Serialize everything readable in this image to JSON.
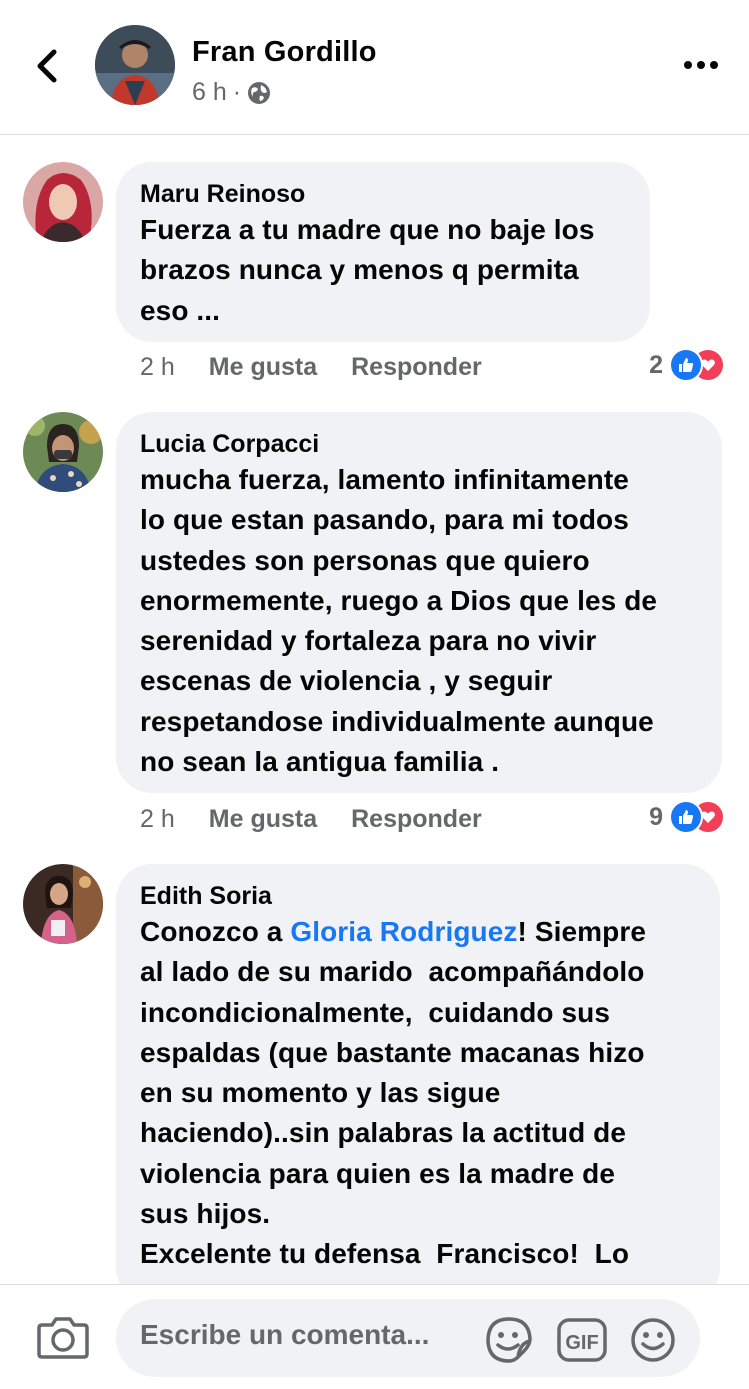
{
  "header": {
    "name": "Fran Gordillo",
    "time": "6 h",
    "separator": "·",
    "back_icon": "chevron-left-icon",
    "privacy_icon": "globe-icon",
    "more_icon": "more-dots-icon"
  },
  "comments": [
    {
      "author": "Maru Reinoso",
      "text": "Fuerza a tu madre que no baje los\nbrazos nunca y menos q permita\neso ...",
      "time": "2 h",
      "like_label": "Me gusta",
      "reply_label": "Responder",
      "reaction_count": "2"
    },
    {
      "author": "Lucia Corpacci",
      "text": "mucha fuerza, lamento infinitamente\nlo que estan pasando, para mi todos\nustedes son personas que quiero\nenormemente, ruego a Dios que les de\nserenidad y fortaleza para no vivir\nescenas de violencia , y seguir\nrespetandose individualmente aunque\nno sean la antigua familia .",
      "time": "2 h",
      "like_label": "Me gusta",
      "reply_label": "Responder",
      "reaction_count": "9"
    },
    {
      "author": "Edith Soria",
      "text_before": "Conozco a ",
      "mention": "Gloria Rodriguez",
      "text_after": "! Siempre\nal lado de su marido  acompañándolo\nincondicionalmente,  cuidando sus\nespaldas (que bastante macanas hizo\nen su momento y las sigue\nhaciendo)..sin palabras la actitud de\nviolencia para quien es la madre de\nsus hijos.\nExcelente tu defensa  Francisco!  Lo"
    }
  ],
  "composer": {
    "placeholder": "Escribe un comenta...",
    "camera_icon": "camera-icon",
    "sticker_icon": "sticker-icon",
    "gif_label": "GIF",
    "emoji_icon": "emoji-icon"
  },
  "colors": {
    "accent": "#1877f2",
    "love": "#f33e58",
    "bubble_bg": "#f0f2f5",
    "secondary_text": "#65676b"
  }
}
